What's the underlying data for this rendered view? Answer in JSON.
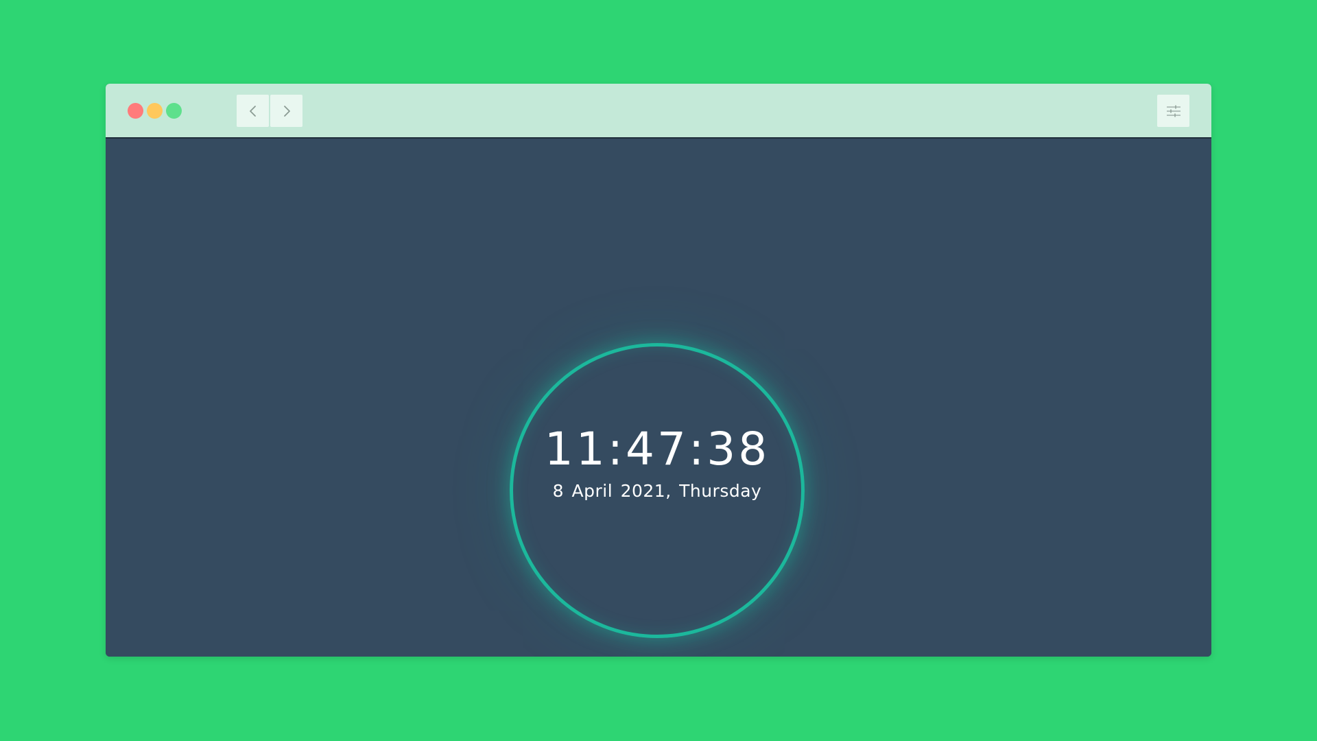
{
  "window": {
    "traffic_lights": {
      "close_color": "#ff7b7b",
      "minimize_color": "#ffc85c",
      "maximize_color": "#5ee08c"
    },
    "nav": {
      "back_icon": "chevron-left-icon",
      "forward_icon": "chevron-right-icon"
    },
    "settings_icon": "sliders-icon"
  },
  "clock": {
    "time": "11:47:38",
    "date": "8 April 2021, Thursday",
    "ring_color": "#1cb89c"
  },
  "colors": {
    "page_background": "#2ed573",
    "title_bar": "#c4e9d8",
    "content_background": "#354b60",
    "text": "#ffffff"
  }
}
